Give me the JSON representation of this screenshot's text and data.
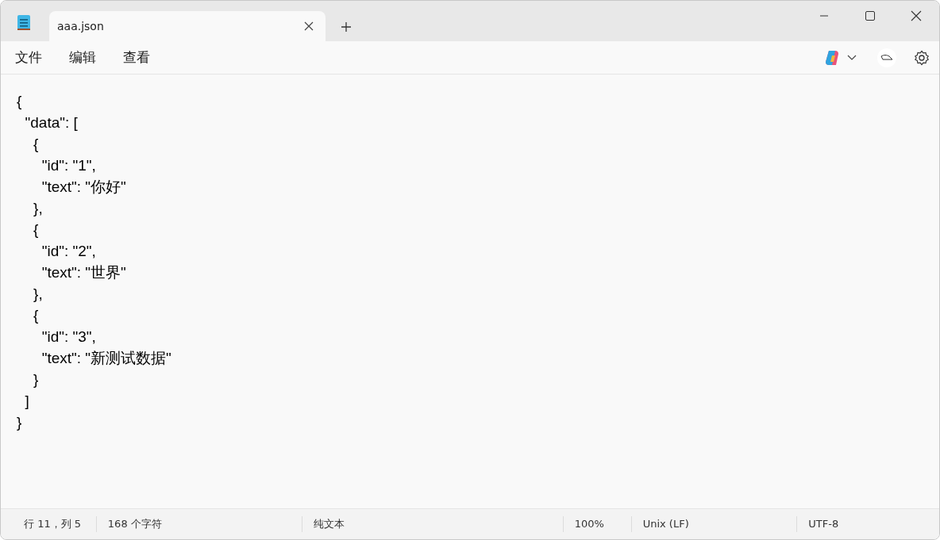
{
  "tabs": [
    {
      "label": "aaa.json",
      "selected": true
    }
  ],
  "menu": [
    "文件",
    "编辑",
    "查看"
  ],
  "editor": {
    "lines": [
      "{",
      "  \"data\": [",
      "    {",
      "      \"id\": \"1\",",
      "      \"text\": \"你好\"",
      "    },",
      "    {",
      "      \"id\": \"2\",",
      "      \"text\": \"世界\"",
      "    },",
      "    {",
      "      \"id\": \"3\",",
      "      \"text\": \"新测试数据\"",
      "    }",
      "  ]",
      "}"
    ]
  },
  "status_bar": [
    "行 11，列 5",
    "168 个字符",
    "纯文本",
    "100%",
    "Unix (LF)",
    "UTF-8"
  ]
}
